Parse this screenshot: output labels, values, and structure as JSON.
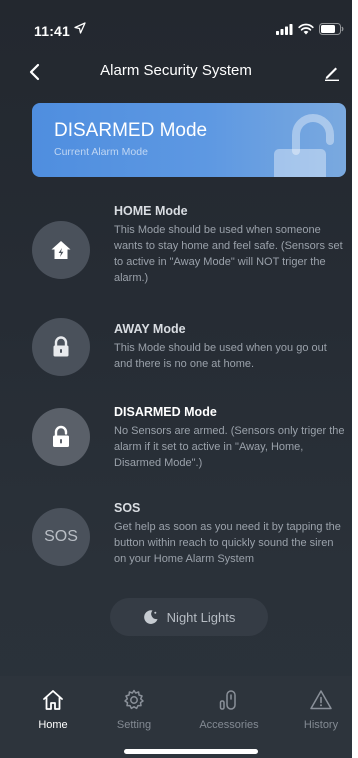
{
  "status_bar": {
    "time": "11:41",
    "location_icon": "location-arrow-icon",
    "signal_icon": "cellular-signal-icon",
    "wifi_icon": "wifi-icon",
    "battery_icon": "battery-icon"
  },
  "nav": {
    "title": "Alarm Security System",
    "back_icon": "chevron-left-icon",
    "edit_icon": "pencil-icon"
  },
  "current_mode": {
    "title": "DISARMED Mode",
    "subtitle": "Current Alarm Mode",
    "icon": "unlocked-padlock-icon",
    "accent": "#5b96e2"
  },
  "modes": [
    {
      "title": "HOME Mode",
      "description": "This Mode should be used when someone wants to stay home and feel safe. (Sensors set to active in \"Away Mode\" will NOT triger the alarm.)",
      "icon": "home-icon"
    },
    {
      "title": "AWAY Mode",
      "description": "This Mode should be used when you go out and there is no one at home.",
      "icon": "lock-icon"
    },
    {
      "title": "DISARMED Mode",
      "description": "No Sensors are armed. (Sensors only triger the alarm if it set to active in \"Away, Home, Disarmed Mode\".)",
      "icon": "unlock-icon",
      "active": true
    },
    {
      "title": "SOS",
      "circle_label": "SOS",
      "description": "Get help as soon as you need it by tapping the button within reach to quickly sound the siren on your Home Alarm System",
      "icon": "sos-icon"
    }
  ],
  "night_lights": {
    "label": "Night Lights",
    "icon": "moon-icon"
  },
  "tabs": [
    {
      "label": "Home",
      "icon": "home-outline-icon",
      "active": true
    },
    {
      "label": "Setting",
      "icon": "gear-icon"
    },
    {
      "label": "Accessories",
      "icon": "sensor-icon"
    },
    {
      "label": "History",
      "icon": "warning-triangle-icon"
    }
  ]
}
